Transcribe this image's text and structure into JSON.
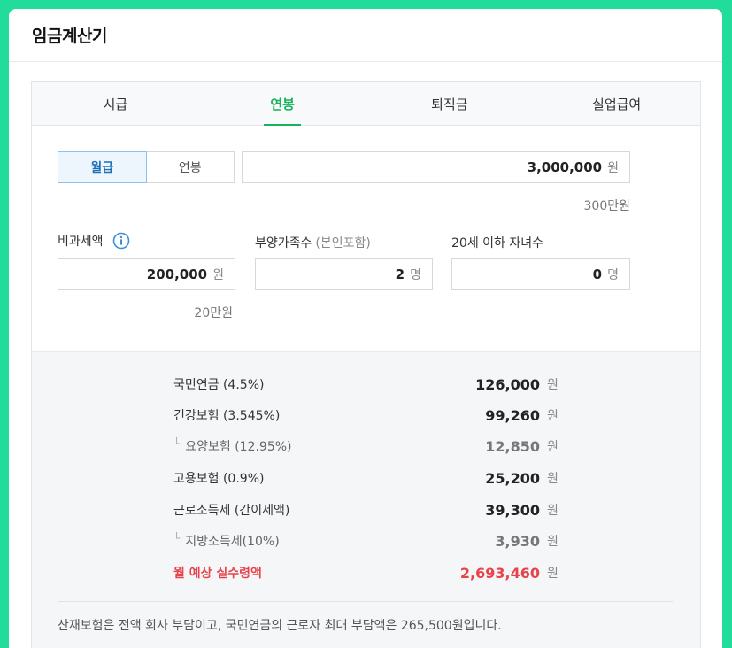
{
  "header": {
    "title": "임금계산기"
  },
  "tabs": [
    {
      "label": "시급",
      "active": false
    },
    {
      "label": "연봉",
      "active": true
    },
    {
      "label": "퇴직금",
      "active": false
    },
    {
      "label": "실업급여",
      "active": false
    }
  ],
  "salary": {
    "type_options": [
      {
        "label": "월급",
        "selected": true
      },
      {
        "label": "연봉",
        "selected": false
      }
    ],
    "amount": "3,000,000",
    "unit": "원",
    "amount_hint": "300만원"
  },
  "nontaxable": {
    "label": "비과세액",
    "value": "200,000",
    "unit": "원",
    "hint": "20만원",
    "icon": "info-icon"
  },
  "dependents": {
    "label": "부양가족수",
    "sublabel": "(본인포함)",
    "value": "2",
    "unit": "명"
  },
  "children": {
    "label": "20세 이하 자녀수",
    "value": "0",
    "unit": "명"
  },
  "results": {
    "won": "원",
    "rows": [
      {
        "name": "국민연금 (4.5%)",
        "amount": "126,000"
      },
      {
        "name": "건강보험 (3.545%)",
        "amount": "99,260"
      },
      {
        "name": "요양보험 (12.95%)",
        "amount": "12,850"
      },
      {
        "name": "고용보험 (0.9%)",
        "amount": "25,200"
      },
      {
        "name": "근로소득세 (간이세액)",
        "amount": "39,300"
      },
      {
        "name": "지방소득세(10%)",
        "amount": "3,930"
      },
      {
        "name": "월 예상 실수령액",
        "amount": "2,693,460"
      }
    ],
    "note": "산재보험은 전액 회사 부담이고, 국민연금의 근로자 최대 부담액은 265,500원입니다."
  },
  "colors": {
    "accent_green": "#16b35a",
    "total_red": "#e8434b",
    "frame_green": "#21dc9b",
    "info_blue": "#3b8ed8"
  }
}
